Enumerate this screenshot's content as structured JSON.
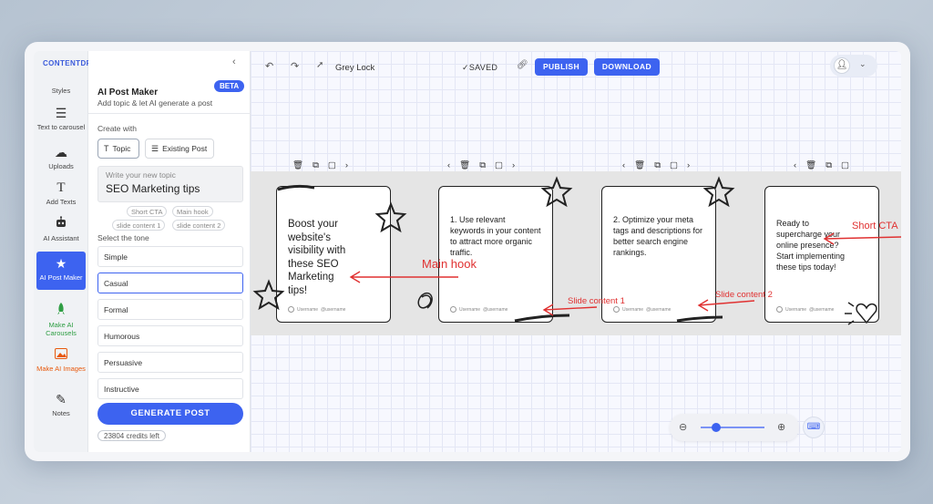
{
  "brand": "CONTENTDRIPS",
  "rail": [
    {
      "label": "Styles",
      "icon": "styles-icon"
    },
    {
      "label": "Text to carousel",
      "icon": "list-icon"
    },
    {
      "label": "Uploads",
      "icon": "cloud-upload-icon"
    },
    {
      "label": "Add Texts",
      "icon": "text-icon"
    },
    {
      "label": "AI Assistant",
      "icon": "robot-icon"
    },
    {
      "label": "AI Post Maker",
      "icon": "star-icon",
      "active": true
    },
    {
      "label": "Make AI Carousels",
      "icon": "rocket-icon",
      "color": "#2f9e44"
    },
    {
      "label": "Make AI Images",
      "icon": "image-icon",
      "color": "#e8590c"
    },
    {
      "label": "Notes",
      "icon": "pen-icon"
    }
  ],
  "panel": {
    "title": "AI Post Maker",
    "badge": "BETA",
    "subtitle": "Add topic & let AI generate a post",
    "create_with_label": "Create with",
    "create_options": [
      "Topic",
      "Existing Post"
    ],
    "topic_placeholder": "Write your new topic",
    "topic_value": "SEO Marketing tips",
    "chips": [
      "Short CTA",
      "Main hook",
      "slide content 1",
      "slide content 2"
    ],
    "tone_label": "Select the tone",
    "tones": [
      "Simple",
      "Casual",
      "Formal",
      "Humorous",
      "Persuasive",
      "Instructive"
    ],
    "selected_tone": "Casual",
    "generate_label": "GENERATE POST",
    "credits": "23804 credits left"
  },
  "toolbar": {
    "doc_name": "Grey Lock",
    "saved": "✓SAVED",
    "publish": "PUBLISH",
    "download": "DOWNLOAD"
  },
  "slides": [
    {
      "text": "Boost your website's visibility with these SEO Marketing tips!",
      "name_line": "Username",
      "handle": "@username"
    },
    {
      "text": "1. Use relevant keywords in your content to attract more organic traffic.",
      "name_line": "Username",
      "handle": "@username"
    },
    {
      "text": "2. Optimize your meta tags and descriptions for better search engine rankings.",
      "name_line": "Username",
      "handle": "@username"
    },
    {
      "text": "Ready to supercharge your online presence? Start implementing these tips today!",
      "name_line": "Username",
      "handle": "@username"
    }
  ],
  "annotations": {
    "main_hook": "Main hook",
    "slide_content_1": "Slide content 1",
    "slide_content_2": "Slide content 2",
    "short_cta": "Short CTA"
  },
  "colors": {
    "accent": "#3d63f0",
    "annotation": "#e03131"
  }
}
